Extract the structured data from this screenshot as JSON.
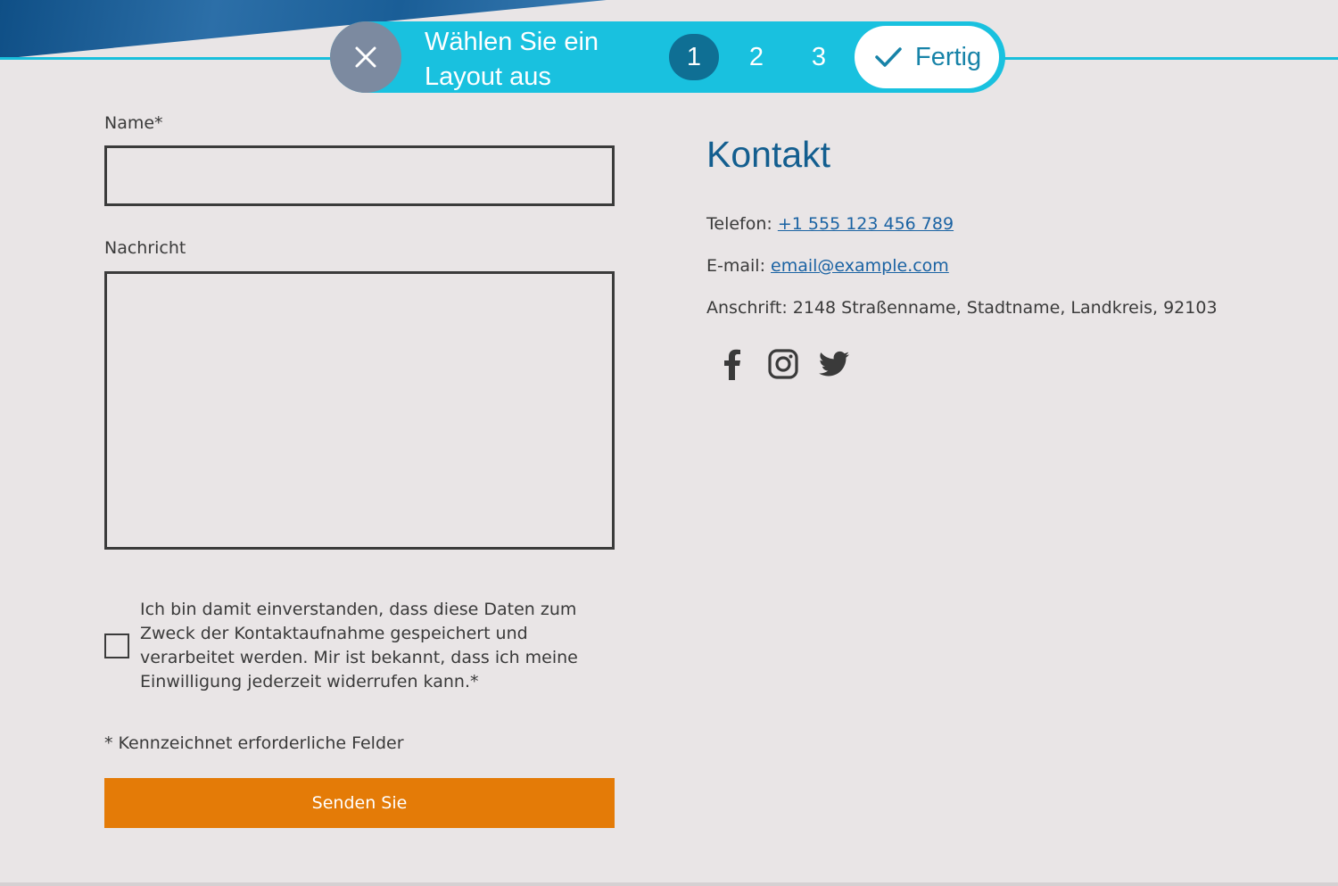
{
  "wizard": {
    "title": "Wählen Sie ein Layout aus",
    "steps": [
      "1",
      "2",
      "3"
    ],
    "active_step": "1",
    "done_label": "Fertig"
  },
  "form": {
    "name_label": "Name*",
    "name_value": "",
    "message_label": "Nachricht",
    "message_value": "",
    "consent_text": "Ich bin damit einverstanden, dass diese Daten zum Zweck der Kontaktaufnahme gespeichert und verarbeitet werden. Mir ist bekannt, dass ich meine Einwilligung jederzeit widerrufen kann.*",
    "consent_checked": false,
    "required_note": "* Kennzeichnet erforderliche Felder",
    "submit_label": "Senden Sie"
  },
  "contact": {
    "title": "Kontakt",
    "phone_label": "Telefon: ",
    "phone": "+1 555 123 456 789",
    "email_label": "E-mail: ",
    "email": "email@example.com",
    "address_label": "Anschrift: ",
    "address": "2148 Straßenname, Stadtname, Landkreis, 92103",
    "social": [
      "facebook-icon",
      "instagram-icon",
      "twitter-icon"
    ]
  },
  "colors": {
    "accent_cyan": "#19c1df",
    "active_step": "#0f6f94",
    "close_button": "#7c8aa0",
    "heading_blue": "#135e8f",
    "link_blue": "#1b63a3",
    "submit_orange": "#e47b07",
    "background": "#e9e5e6"
  }
}
